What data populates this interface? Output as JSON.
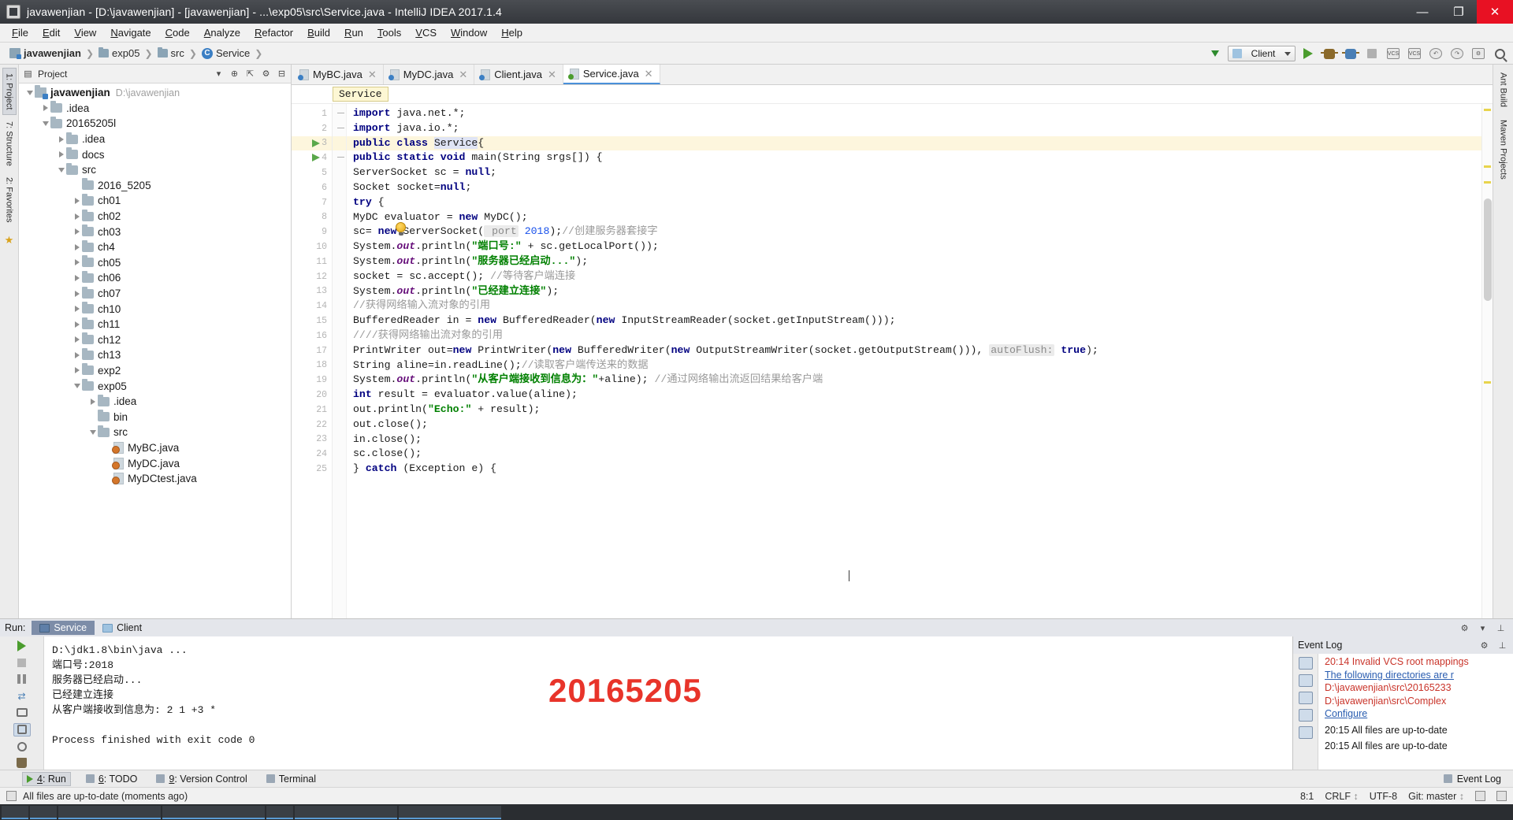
{
  "window": {
    "title": "javawenjian - [D:\\javawenjian] - [javawenjian] - ...\\exp05\\src\\Service.java - IntelliJ IDEA 2017.1.4",
    "minimize": "—",
    "maximize": "❐",
    "close": "✕"
  },
  "menu": [
    "File",
    "Edit",
    "View",
    "Navigate",
    "Code",
    "Analyze",
    "Refactor",
    "Build",
    "Run",
    "Tools",
    "VCS",
    "Window",
    "Help"
  ],
  "navbar": {
    "crumbs": [
      "javawenjian",
      "exp05",
      "src",
      "Service"
    ],
    "run_config": "Client"
  },
  "project": {
    "panel_title": "Project",
    "tree": [
      {
        "depth": 0,
        "twist": "down",
        "icon": "project-root",
        "label": "javawenjian",
        "bold": true,
        "path": "D:\\javawenjian"
      },
      {
        "depth": 1,
        "twist": "right",
        "icon": "folder",
        "label": ".idea"
      },
      {
        "depth": 1,
        "twist": "down",
        "icon": "folder",
        "label": "20165205l"
      },
      {
        "depth": 2,
        "twist": "right",
        "icon": "folder",
        "label": ".idea"
      },
      {
        "depth": 2,
        "twist": "right",
        "icon": "folder",
        "label": "docs"
      },
      {
        "depth": 2,
        "twist": "down",
        "icon": "folder",
        "label": "src"
      },
      {
        "depth": 3,
        "twist": "none",
        "icon": "folder",
        "label": "2016_5205"
      },
      {
        "depth": 3,
        "twist": "right",
        "icon": "folder",
        "label": "ch01"
      },
      {
        "depth": 3,
        "twist": "right",
        "icon": "folder",
        "label": "ch02"
      },
      {
        "depth": 3,
        "twist": "right",
        "icon": "folder",
        "label": "ch03"
      },
      {
        "depth": 3,
        "twist": "right",
        "icon": "folder",
        "label": "ch4"
      },
      {
        "depth": 3,
        "twist": "right",
        "icon": "folder",
        "label": "ch05"
      },
      {
        "depth": 3,
        "twist": "right",
        "icon": "folder",
        "label": "ch06"
      },
      {
        "depth": 3,
        "twist": "right",
        "icon": "folder",
        "label": "ch07"
      },
      {
        "depth": 3,
        "twist": "right",
        "icon": "folder",
        "label": "ch10"
      },
      {
        "depth": 3,
        "twist": "right",
        "icon": "folder",
        "label": "ch11"
      },
      {
        "depth": 3,
        "twist": "right",
        "icon": "folder",
        "label": "ch12"
      },
      {
        "depth": 3,
        "twist": "right",
        "icon": "folder",
        "label": "ch13"
      },
      {
        "depth": 3,
        "twist": "right",
        "icon": "folder",
        "label": "exp2"
      },
      {
        "depth": 3,
        "twist": "down",
        "icon": "folder",
        "label": "exp05"
      },
      {
        "depth": 4,
        "twist": "right",
        "icon": "folder",
        "label": ".idea"
      },
      {
        "depth": 4,
        "twist": "none",
        "icon": "folder",
        "label": "bin"
      },
      {
        "depth": 4,
        "twist": "down",
        "icon": "folder",
        "label": "src"
      },
      {
        "depth": 5,
        "twist": "none",
        "icon": "java",
        "label": "MyBC.java"
      },
      {
        "depth": 5,
        "twist": "none",
        "icon": "java",
        "label": "MyDC.java"
      },
      {
        "depth": 5,
        "twist": "none",
        "icon": "java",
        "label": "MyDCtest.java"
      }
    ]
  },
  "left_strip": [
    "1: Project",
    "7: Structure",
    "2: Favorites"
  ],
  "right_strip": [
    "Ant Build",
    "Maven Projects"
  ],
  "editor": {
    "tabs": [
      {
        "label": "MyBC.java",
        "active": false
      },
      {
        "label": "MyDC.java",
        "active": false
      },
      {
        "label": "Client.java",
        "active": false
      },
      {
        "label": "Service.java",
        "active": true
      }
    ],
    "breadcrumb_chip": "Service",
    "lines": [
      {
        "n": 1,
        "fold": "minus",
        "run": false,
        "hl": false,
        "tokens": [
          {
            "t": "import",
            "c": "kw"
          },
          {
            "t": " java.net.*;",
            "c": ""
          }
        ]
      },
      {
        "n": 2,
        "fold": "minus",
        "run": false,
        "hl": false,
        "tokens": [
          {
            "t": "import",
            "c": "kw"
          },
          {
            "t": " java.io.*;",
            "c": ""
          }
        ]
      },
      {
        "n": 3,
        "fold": "none",
        "run": true,
        "hl": true,
        "tokens": [
          {
            "t": "public class ",
            "c": "kw"
          },
          {
            "t": "Service",
            "c": "clsname"
          },
          {
            "t": "{",
            "c": ""
          }
        ]
      },
      {
        "n": 4,
        "fold": "minus",
        "run": true,
        "hl": false,
        "tokens": [
          {
            "t": "    ",
            "c": ""
          },
          {
            "t": "public static void ",
            "c": "kw"
          },
          {
            "t": "main(String srgs[]) {",
            "c": ""
          }
        ]
      },
      {
        "n": 5,
        "fold": "none",
        "run": false,
        "hl": false,
        "tokens": [
          {
            "t": "        ServerSocket sc = ",
            "c": ""
          },
          {
            "t": "null",
            "c": "kw"
          },
          {
            "t": ";",
            "c": ""
          }
        ]
      },
      {
        "n": 6,
        "fold": "none",
        "run": false,
        "hl": false,
        "tokens": [
          {
            "t": "        Socket socket=",
            "c": ""
          },
          {
            "t": "null",
            "c": "kw"
          },
          {
            "t": ";",
            "c": ""
          }
        ]
      },
      {
        "n": 7,
        "fold": "none",
        "run": false,
        "hl": false,
        "tokens": [
          {
            "t": "        ",
            "c": ""
          },
          {
            "t": "try",
            "c": "kw"
          },
          {
            "t": " {",
            "c": ""
          }
        ]
      },
      {
        "n": 8,
        "fold": "none",
        "run": false,
        "hl": false,
        "tokens": [
          {
            "t": "            MyDC evaluator = ",
            "c": ""
          },
          {
            "t": "new",
            "c": "kw"
          },
          {
            "t": " MyDC();",
            "c": ""
          }
        ]
      },
      {
        "n": 9,
        "fold": "none",
        "run": false,
        "hl": false,
        "tokens": [
          {
            "t": "            sc= ",
            "c": ""
          },
          {
            "t": "new",
            "c": "kw"
          },
          {
            "t": " ServerSocket(",
            "c": ""
          },
          {
            "t": " port",
            "c": "hint"
          },
          {
            "t": " ",
            "c": ""
          },
          {
            "t": "2018",
            "c": "num"
          },
          {
            "t": ");",
            "c": ""
          },
          {
            "t": "//创建服务器套接字",
            "c": "cmt"
          }
        ]
      },
      {
        "n": 10,
        "fold": "none",
        "run": false,
        "hl": false,
        "tokens": [
          {
            "t": "            System.",
            "c": ""
          },
          {
            "t": "out",
            "c": "fld"
          },
          {
            "t": ".println(",
            "c": ""
          },
          {
            "t": "\"端口号:\"",
            "c": "str"
          },
          {
            "t": " + sc.getLocalPort());",
            "c": ""
          }
        ]
      },
      {
        "n": 11,
        "fold": "none",
        "run": false,
        "hl": false,
        "tokens": [
          {
            "t": "            System.",
            "c": ""
          },
          {
            "t": "out",
            "c": "fld"
          },
          {
            "t": ".println(",
            "c": ""
          },
          {
            "t": "\"服务器已经启动...\"",
            "c": "str"
          },
          {
            "t": ");",
            "c": ""
          }
        ]
      },
      {
        "n": 12,
        "fold": "none",
        "run": false,
        "hl": false,
        "tokens": [
          {
            "t": "            socket = sc.accept();    ",
            "c": ""
          },
          {
            "t": "//等待客户端连接",
            "c": "cmt"
          }
        ]
      },
      {
        "n": 13,
        "fold": "none",
        "run": false,
        "hl": false,
        "tokens": [
          {
            "t": "            System.",
            "c": ""
          },
          {
            "t": "out",
            "c": "fld"
          },
          {
            "t": ".println(",
            "c": ""
          },
          {
            "t": "\"已经建立连接\"",
            "c": "str"
          },
          {
            "t": ");",
            "c": ""
          }
        ]
      },
      {
        "n": 14,
        "fold": "none",
        "run": false,
        "hl": false,
        "tokens": [
          {
            "t": "            //获得网络输入流对象的引用",
            "c": "cmt"
          }
        ]
      },
      {
        "n": 15,
        "fold": "none",
        "run": false,
        "hl": false,
        "tokens": [
          {
            "t": "            BufferedReader in = ",
            "c": ""
          },
          {
            "t": "new",
            "c": "kw"
          },
          {
            "t": " BufferedReader(",
            "c": ""
          },
          {
            "t": "new",
            "c": "kw"
          },
          {
            "t": " InputStreamReader(socket.getInputStream()));",
            "c": ""
          }
        ]
      },
      {
        "n": 16,
        "fold": "none",
        "run": false,
        "hl": false,
        "tokens": [
          {
            "t": "            ////获得网络输出流对象的引用",
            "c": "cmt"
          }
        ]
      },
      {
        "n": 17,
        "fold": "none",
        "run": false,
        "hl": false,
        "tokens": [
          {
            "t": "            PrintWriter out=",
            "c": ""
          },
          {
            "t": "new",
            "c": "kw"
          },
          {
            "t": " PrintWriter(",
            "c": ""
          },
          {
            "t": "new",
            "c": "kw"
          },
          {
            "t": " BufferedWriter(",
            "c": ""
          },
          {
            "t": "new",
            "c": "kw"
          },
          {
            "t": " OutputStreamWriter(socket.getOutputStream())), ",
            "c": ""
          },
          {
            "t": "autoFlush:",
            "c": "hint"
          },
          {
            "t": " ",
            "c": ""
          },
          {
            "t": "true",
            "c": "kw"
          },
          {
            "t": ");",
            "c": ""
          }
        ]
      },
      {
        "n": 18,
        "fold": "none",
        "run": false,
        "hl": false,
        "tokens": [
          {
            "t": "            String aline=in.readLine();",
            "c": ""
          },
          {
            "t": "//读取客户端传送来的数据",
            "c": "cmt"
          }
        ]
      },
      {
        "n": 19,
        "fold": "none",
        "run": false,
        "hl": false,
        "tokens": [
          {
            "t": "            System.",
            "c": ""
          },
          {
            "t": "out",
            "c": "fld"
          },
          {
            "t": ".println(",
            "c": ""
          },
          {
            "t": "\"从客户端接收到信息为：\"",
            "c": "str"
          },
          {
            "t": "+aline);  ",
            "c": ""
          },
          {
            "t": "//通过网络输出流返回结果给客户端",
            "c": "cmt"
          }
        ]
      },
      {
        "n": 20,
        "fold": "none",
        "run": false,
        "hl": false,
        "tokens": [
          {
            "t": "            ",
            "c": ""
          },
          {
            "t": "int",
            "c": "kw"
          },
          {
            "t": " result = evaluator.value(aline);",
            "c": ""
          }
        ]
      },
      {
        "n": 21,
        "fold": "none",
        "run": false,
        "hl": false,
        "tokens": [
          {
            "t": "            out.println(",
            "c": ""
          },
          {
            "t": "\"Echo:\"",
            "c": "str"
          },
          {
            "t": " + result);",
            "c": ""
          }
        ]
      },
      {
        "n": 22,
        "fold": "none",
        "run": false,
        "hl": false,
        "tokens": [
          {
            "t": "            out.close();",
            "c": ""
          }
        ]
      },
      {
        "n": 23,
        "fold": "none",
        "run": false,
        "hl": false,
        "tokens": [
          {
            "t": "            in.close();",
            "c": ""
          }
        ]
      },
      {
        "n": 24,
        "fold": "none",
        "run": false,
        "hl": false,
        "tokens": [
          {
            "t": "            sc.close();",
            "c": ""
          }
        ]
      },
      {
        "n": 25,
        "fold": "none",
        "run": false,
        "hl": false,
        "tokens": [
          {
            "t": "        } ",
            "c": ""
          },
          {
            "t": "catch",
            "c": "kw"
          },
          {
            "t": " (Exception e) {",
            "c": ""
          }
        ]
      }
    ]
  },
  "run": {
    "label": "Run:",
    "tabs": [
      {
        "label": "Service",
        "active": true
      },
      {
        "label": "Client",
        "active": false
      }
    ],
    "console": [
      "D:\\jdk1.8\\bin\\java ...",
      "端口号:2018",
      "服务器已经启动...",
      "已经建立连接",
      "从客户端接收到信息为: 2 1 +3 *",
      "",
      "Process finished with exit code 0"
    ],
    "watermark": "20165205"
  },
  "event_log": {
    "title": "Event Log",
    "entries": [
      {
        "text": "20:14  Invalid VCS root mappings",
        "kind": "red"
      },
      {
        "text": "The following directories are r",
        "kind": "link"
      },
      {
        "text": "D:\\javawenjian\\src\\20165233",
        "kind": "red"
      },
      {
        "text": "D:\\javawenjian\\src\\Complex",
        "kind": "red"
      },
      {
        "text": "Configure",
        "kind": "link"
      },
      {
        "text": "20:15  All files are up-to-date",
        "kind": "norm"
      },
      {
        "text": "20:15  All files are up-to-date",
        "kind": "norm"
      }
    ]
  },
  "bottom_tabs": [
    {
      "label": "4: Run",
      "active": true,
      "icon": "play-icon"
    },
    {
      "label": "6: TODO",
      "active": false,
      "icon": "todo-icon"
    },
    {
      "label": "9: Version Control",
      "active": false,
      "icon": "vcs-icon"
    },
    {
      "label": "Terminal",
      "active": false,
      "icon": "terminal-icon"
    },
    {
      "label": "Event Log",
      "active": false,
      "icon": "eventlog-icon"
    }
  ],
  "status_bar": {
    "message": "All files are up-to-date (moments ago)",
    "caret": "8:1",
    "line_sep": "CRLF",
    "encoding": "UTF-8",
    "branch": "Git: master"
  }
}
